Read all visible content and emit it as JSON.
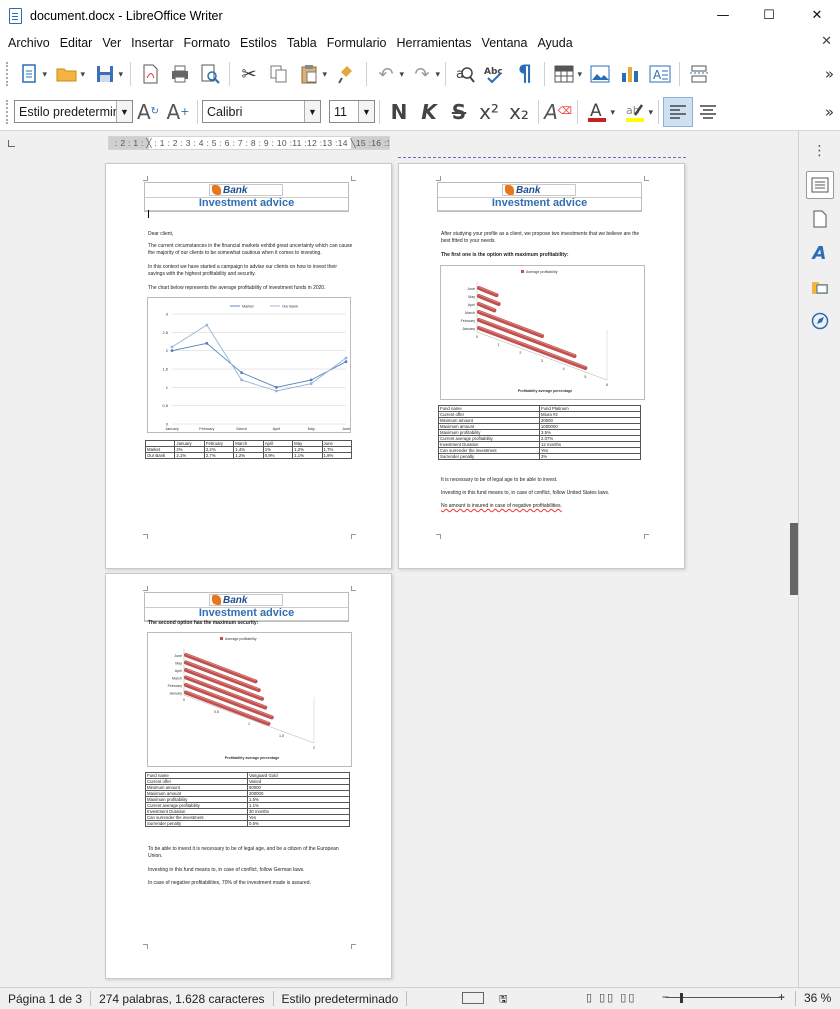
{
  "window": {
    "title": "document.docx - LibreOffice Writer",
    "controls": [
      "—",
      "☐",
      "✕"
    ]
  },
  "menu": [
    "Archivo",
    "Editar",
    "Ver",
    "Insertar",
    "Formato",
    "Estilos",
    "Tabla",
    "Formulario",
    "Herramientas",
    "Ventana",
    "Ayuda"
  ],
  "formatting": {
    "paragraph_style": "Estilo predeterminado",
    "font_name": "Calibri",
    "font_size": "11",
    "bold_label": "N",
    "italic_label": "K",
    "strike_label": "S",
    "super_label": "x²",
    "sub_label": "x₂"
  },
  "ruler": {
    "text": ": 2 : 1 : ╳ : 1 : 2 : 3 : 4 : 5 : 6 : 7 : 8 : 9 : 10 :11 :12 :13 :14 ╲15 :16 :17 :"
  },
  "doc": {
    "header_logo": "Bank",
    "header_title": "Investment advice",
    "page1": {
      "greeting": "Dear client,",
      "p1": "The current circumstances in the financial markets exhibit great uncertainty which can cause the majority of our clients to be somewhat cautious when it comes to investing.",
      "p2": "In this context we have started a campaign to advise our clients on how to invest their savings with the highest profitability and security.",
      "p3": "The chart below represents the average profitability of investment funds in 2020.",
      "table": {
        "header": [
          "",
          "January",
          "February",
          "March",
          "April",
          "May",
          "June"
        ],
        "rows": [
          [
            "Market",
            "2%",
            "2,2%",
            "1,4%",
            "1%",
            "1,2%",
            "1,7%"
          ],
          [
            "Our Bank",
            "2,1%",
            "2,7%",
            "1,2%",
            "0,9%",
            "1,1%",
            "1,8%"
          ]
        ]
      }
    },
    "page2": {
      "p1": "After studying your profile as a client, we propose two investments that we believe are the best fitted to your needs.",
      "p2": "The first one is the option with maximum profitability:",
      "table": [
        [
          "Fund name",
          "Fund Platinum"
        ],
        [
          "Current offer",
          "Miura #2"
        ],
        [
          "Minimum amount",
          "20000"
        ],
        [
          "Maximum amount",
          "1000000"
        ],
        [
          "Maximum profitability",
          "3.5%"
        ],
        [
          "Current average profitability",
          "2.07%"
        ],
        [
          "Investment Duration",
          "12 months"
        ],
        [
          "Can surrender the investment",
          "Yes"
        ],
        [
          "Surrender penalty",
          "3%"
        ]
      ],
      "p3": "It is necessary to be of legal age to be able to invest.",
      "p4": "Investing in this fund means to, in case of conflict, follow United States laws.",
      "p5": "No amount is insured in case of negative profitabilities."
    },
    "page3": {
      "p1": "The second option has the maximum security:",
      "table": [
        [
          "Fund name",
          "Vanguard Gold"
        ],
        [
          "Current offer",
          "Varied"
        ],
        [
          "Minimum amount",
          "50000"
        ],
        [
          "Maximum amount",
          "200000"
        ],
        [
          "Maximum profitability",
          "1.5%"
        ],
        [
          "Current average profitability",
          "1.1%"
        ],
        [
          "Investment Duration",
          "30 months"
        ],
        [
          "Can surrender the investment",
          "Yes"
        ],
        [
          "Surrender penalty",
          "0.5%"
        ]
      ],
      "p2": "To be able to invest it is necessary to be of legal age, and be a citizen of the European Union.",
      "p3": "Investing in this fund means to, in case of conflict, follow German laws.",
      "p4": "In case of negative profitabilities, 70% of the investment made is assured."
    }
  },
  "chart_data": [
    {
      "type": "line",
      "categories": [
        "January",
        "February",
        "March",
        "April",
        "May",
        "June"
      ],
      "series": [
        {
          "name": "Market",
          "values": [
            2,
            2.2,
            1.4,
            1,
            1.2,
            1.7
          ]
        },
        {
          "name": "Our Bank",
          "values": [
            2.1,
            2.7,
            1.2,
            0.9,
            1.1,
            1.8
          ]
        }
      ],
      "ylim": [
        0,
        3
      ],
      "yticks": [
        "0",
        "0,5",
        "1",
        "1,5",
        "2",
        "2,5",
        "3"
      ],
      "legend": "top"
    },
    {
      "type": "bar",
      "orientation": "horizontal-3d",
      "categories": [
        "January",
        "February",
        "March",
        "April",
        "May",
        "June"
      ],
      "series": [
        {
          "name": "Average profitability",
          "values": [
            5,
            4.5,
            3,
            0.8,
            1,
            0.9
          ]
        }
      ],
      "xticks": [
        "0",
        "1",
        "2",
        "3",
        "4",
        "5",
        "6"
      ],
      "xlabel": "Profitability average percentage",
      "color": "#c0504d"
    },
    {
      "type": "bar",
      "orientation": "horizontal-3d",
      "categories": [
        "January",
        "February",
        "March",
        "April",
        "May",
        "June"
      ],
      "series": [
        {
          "name": "Average profitability",
          "values": [
            1.3,
            1.35,
            1.25,
            1.2,
            1.15,
            1.1
          ]
        }
      ],
      "xticks": [
        "0",
        "0,5",
        "1",
        "1,5",
        "2"
      ],
      "xlabel": "Profitability average percentage",
      "color": "#c0504d"
    }
  ],
  "status": {
    "page": "Página 1 de 3",
    "words": "274 palabras, 1.628 caracteres",
    "style": "Estilo predeterminado",
    "zoom": "36 %"
  }
}
